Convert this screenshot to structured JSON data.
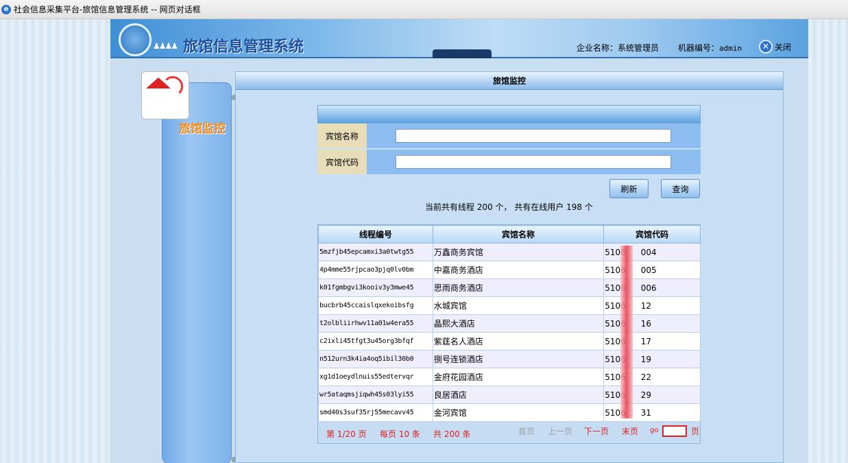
{
  "window": {
    "title": "社会信息采集平台-旅馆信息管理系统 -- 网页对话框"
  },
  "header": {
    "app_title": "旅馆信息管理系统",
    "company_label": "企业名称：系统管理员",
    "machine_label": "机器编号：",
    "machine_value": "admin",
    "close_label": "关闭"
  },
  "sidebar": {
    "title": "旅馆监控"
  },
  "panel": {
    "title": "旅馆监控"
  },
  "form": {
    "hotel_name_label": "宾馆名称",
    "hotel_name_value": "",
    "hotel_code_label": "宾馆代码",
    "hotel_code_value": ""
  },
  "buttons": {
    "refresh": "刷新",
    "query": "查询"
  },
  "summary": "当前共有线程 200 个， 共有在线用户 198 个",
  "table": {
    "headers": [
      "线程编号",
      "宾馆名称",
      "宾馆代码"
    ],
    "rows": [
      [
        "5mzfjb45epcamxi3a0twtg55",
        "万鑫商务宾馆",
        "5106",
        "004"
      ],
      [
        "4p4mme55rjpcao3pjq0lv0bm",
        "中嘉商务酒店",
        "5106",
        "005"
      ],
      [
        "k01fgmbgvi3kooiv3y3mwe45",
        "思雨商务酒店",
        "5106",
        "006"
      ],
      [
        "bucbrb45ccaislqxekoibsfg",
        "水城宾馆",
        "5106",
        "12"
      ],
      [
        "t2olbliirhwv11a01w4era55",
        "晶熙大酒店",
        "5106",
        "16"
      ],
      [
        "c2ixli45tfgt3u45org3bfqf",
        "紫莛名人酒店",
        "5106",
        "17"
      ],
      [
        "n512urn3k4ia4oq5ibil30b0",
        "捌号连锁酒店",
        "5106",
        "19"
      ],
      [
        "xg1d1oeydlnuis55edtervqr",
        "金府花园酒店",
        "5106",
        "22"
      ],
      [
        "wr5ataqmsjiqwh45s03lyi55",
        "良居酒店",
        "5106",
        "29"
      ],
      [
        "smd40s3suf35rj55mecavv45",
        "金河宾馆",
        "5106",
        "31"
      ]
    ]
  },
  "pager": {
    "page_info": "第 1/20 页",
    "per_page": "每页 10 条",
    "total": "共 200 条",
    "first": "首页",
    "prev": "上一页",
    "next": "下一页",
    "last": "末页",
    "go": "go",
    "go_value": "",
    "page_suffix": "页"
  },
  "colors": {
    "pager_active": "#e02020",
    "pager_disabled": "#a0a0a0",
    "label_bg": "#e7ddb8",
    "row_alt": "#eeeefc"
  }
}
